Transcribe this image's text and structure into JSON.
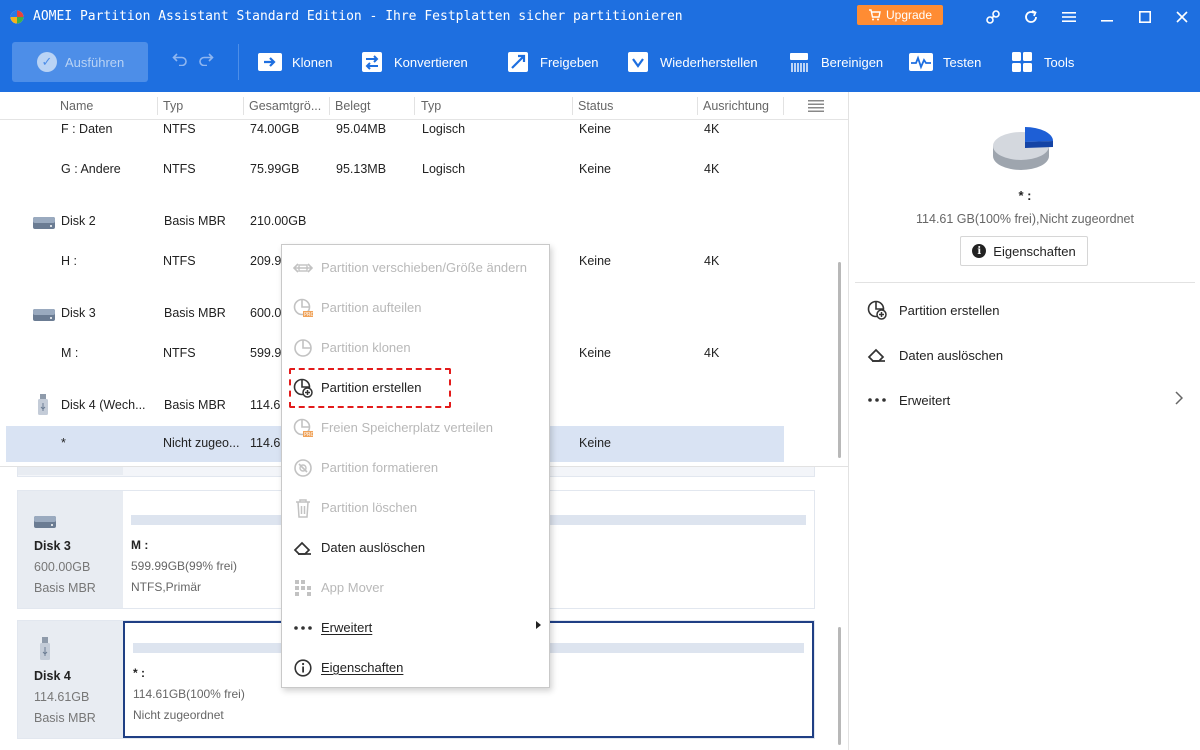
{
  "window": {
    "title": "AOMEI Partition Assistant Standard Edition - Ihre Festplatten sicher partitionieren",
    "upgrade_label": "Upgrade"
  },
  "toolbar": {
    "run_label": "Ausführen",
    "items": [
      {
        "label": "Klonen",
        "icon": "clone-icon"
      },
      {
        "label": "Konvertieren",
        "icon": "convert-icon"
      },
      {
        "label": "Freigeben",
        "icon": "free-space-icon"
      },
      {
        "label": "Wiederherstellen",
        "icon": "recover-icon"
      },
      {
        "label": "Bereinigen",
        "icon": "wipe-icon"
      },
      {
        "label": "Testen",
        "icon": "test-icon"
      },
      {
        "label": "Tools",
        "icon": "tools-icon"
      }
    ]
  },
  "table": {
    "headers": [
      "Name",
      "Typ",
      "Gesamtgrö...",
      "Belegt",
      "Typ",
      "Status",
      "Ausrichtung"
    ],
    "rows": [
      {
        "name": "F : Daten",
        "type": "NTFS",
        "size": "74.00GB",
        "used": "95.04MB",
        "ptype": "Logisch",
        "status": "Keine",
        "align": "4K"
      },
      {
        "name": "G : Andere",
        "type": "NTFS",
        "size": "75.99GB",
        "used": "95.13MB",
        "ptype": "Logisch",
        "status": "Keine",
        "align": "4K"
      },
      {
        "name": "Disk 2",
        "type": "Basis MBR",
        "size": "210.00GB",
        "used": "",
        "ptype": "",
        "status": "",
        "align": ""
      },
      {
        "name": "H :",
        "type": "NTFS",
        "size": "209.9",
        "used": "",
        "ptype": "",
        "status": "Keine",
        "align": "4K"
      },
      {
        "name": "Disk 3",
        "type": "Basis MBR",
        "size": "600.0",
        "used": "",
        "ptype": "",
        "status": "",
        "align": ""
      },
      {
        "name": "M :",
        "type": "NTFS",
        "size": "599.9",
        "used": "",
        "ptype": "",
        "status": "Keine",
        "align": "4K"
      },
      {
        "name": "Disk 4 (Wech...",
        "type": "Basis MBR",
        "size": "114.61",
        "used": "",
        "ptype": "",
        "status": "",
        "align": ""
      },
      {
        "name": "*",
        "type": "Nicht zugeo...",
        "size": "114.61",
        "used": "",
        "ptype": "",
        "status": "Keine",
        "align": ""
      }
    ]
  },
  "disk_map": {
    "disk3": {
      "name": "Disk 3",
      "size": "600.00GB",
      "type": "Basis MBR",
      "part_name": "M :",
      "part_size": "599.99GB(99% frei)",
      "part_fs": "NTFS,Primär"
    },
    "disk4": {
      "name": "Disk 4",
      "size": "114.61GB",
      "type": "Basis MBR",
      "part_name": "* :",
      "part_size": "114.61GB(100% frei)",
      "part_fs": "Nicht zugeordnet"
    }
  },
  "right_panel": {
    "title": "* :",
    "info": "114.61 GB(100% frei),Nicht zugeordnet",
    "properties_label": "Eigenschaften",
    "actions": [
      {
        "label": "Partition erstellen",
        "icon": "create-partition-icon"
      },
      {
        "label": "Daten auslöschen",
        "icon": "eraser-icon"
      },
      {
        "label": "Erweitert",
        "icon": "more-icon"
      }
    ]
  },
  "context_menu": {
    "items": [
      {
        "label": "Partition verschieben/Größe ändern",
        "enabled": false,
        "icon": "resize-icon"
      },
      {
        "label": "Partition aufteilen",
        "enabled": false,
        "icon": "split-icon"
      },
      {
        "label": "Partition klonen",
        "enabled": false,
        "icon": "clone-partition-icon"
      },
      {
        "label": "Partition erstellen",
        "enabled": true,
        "icon": "create-partition-icon"
      },
      {
        "label": "Freien Speicherplatz verteilen",
        "enabled": false,
        "icon": "allocate-space-icon"
      },
      {
        "label": "Partition formatieren",
        "enabled": false,
        "icon": "format-icon"
      },
      {
        "label": "Partition löschen",
        "enabled": false,
        "icon": "trash-icon"
      },
      {
        "label": "Daten auslöschen",
        "enabled": true,
        "icon": "eraser-icon"
      },
      {
        "label": "App Mover",
        "enabled": false,
        "icon": "app-mover-icon"
      },
      {
        "label": "Erweitert",
        "enabled": true,
        "icon": "more-icon"
      },
      {
        "label": "Eigenschaften",
        "enabled": true,
        "icon": "info-icon"
      }
    ]
  },
  "colors": {
    "header_blue": "#1e6fe0",
    "highlight_red": "#e31b1b",
    "selected_row": "#d9e3f3",
    "upgrade_orange": "#ff8c33"
  }
}
